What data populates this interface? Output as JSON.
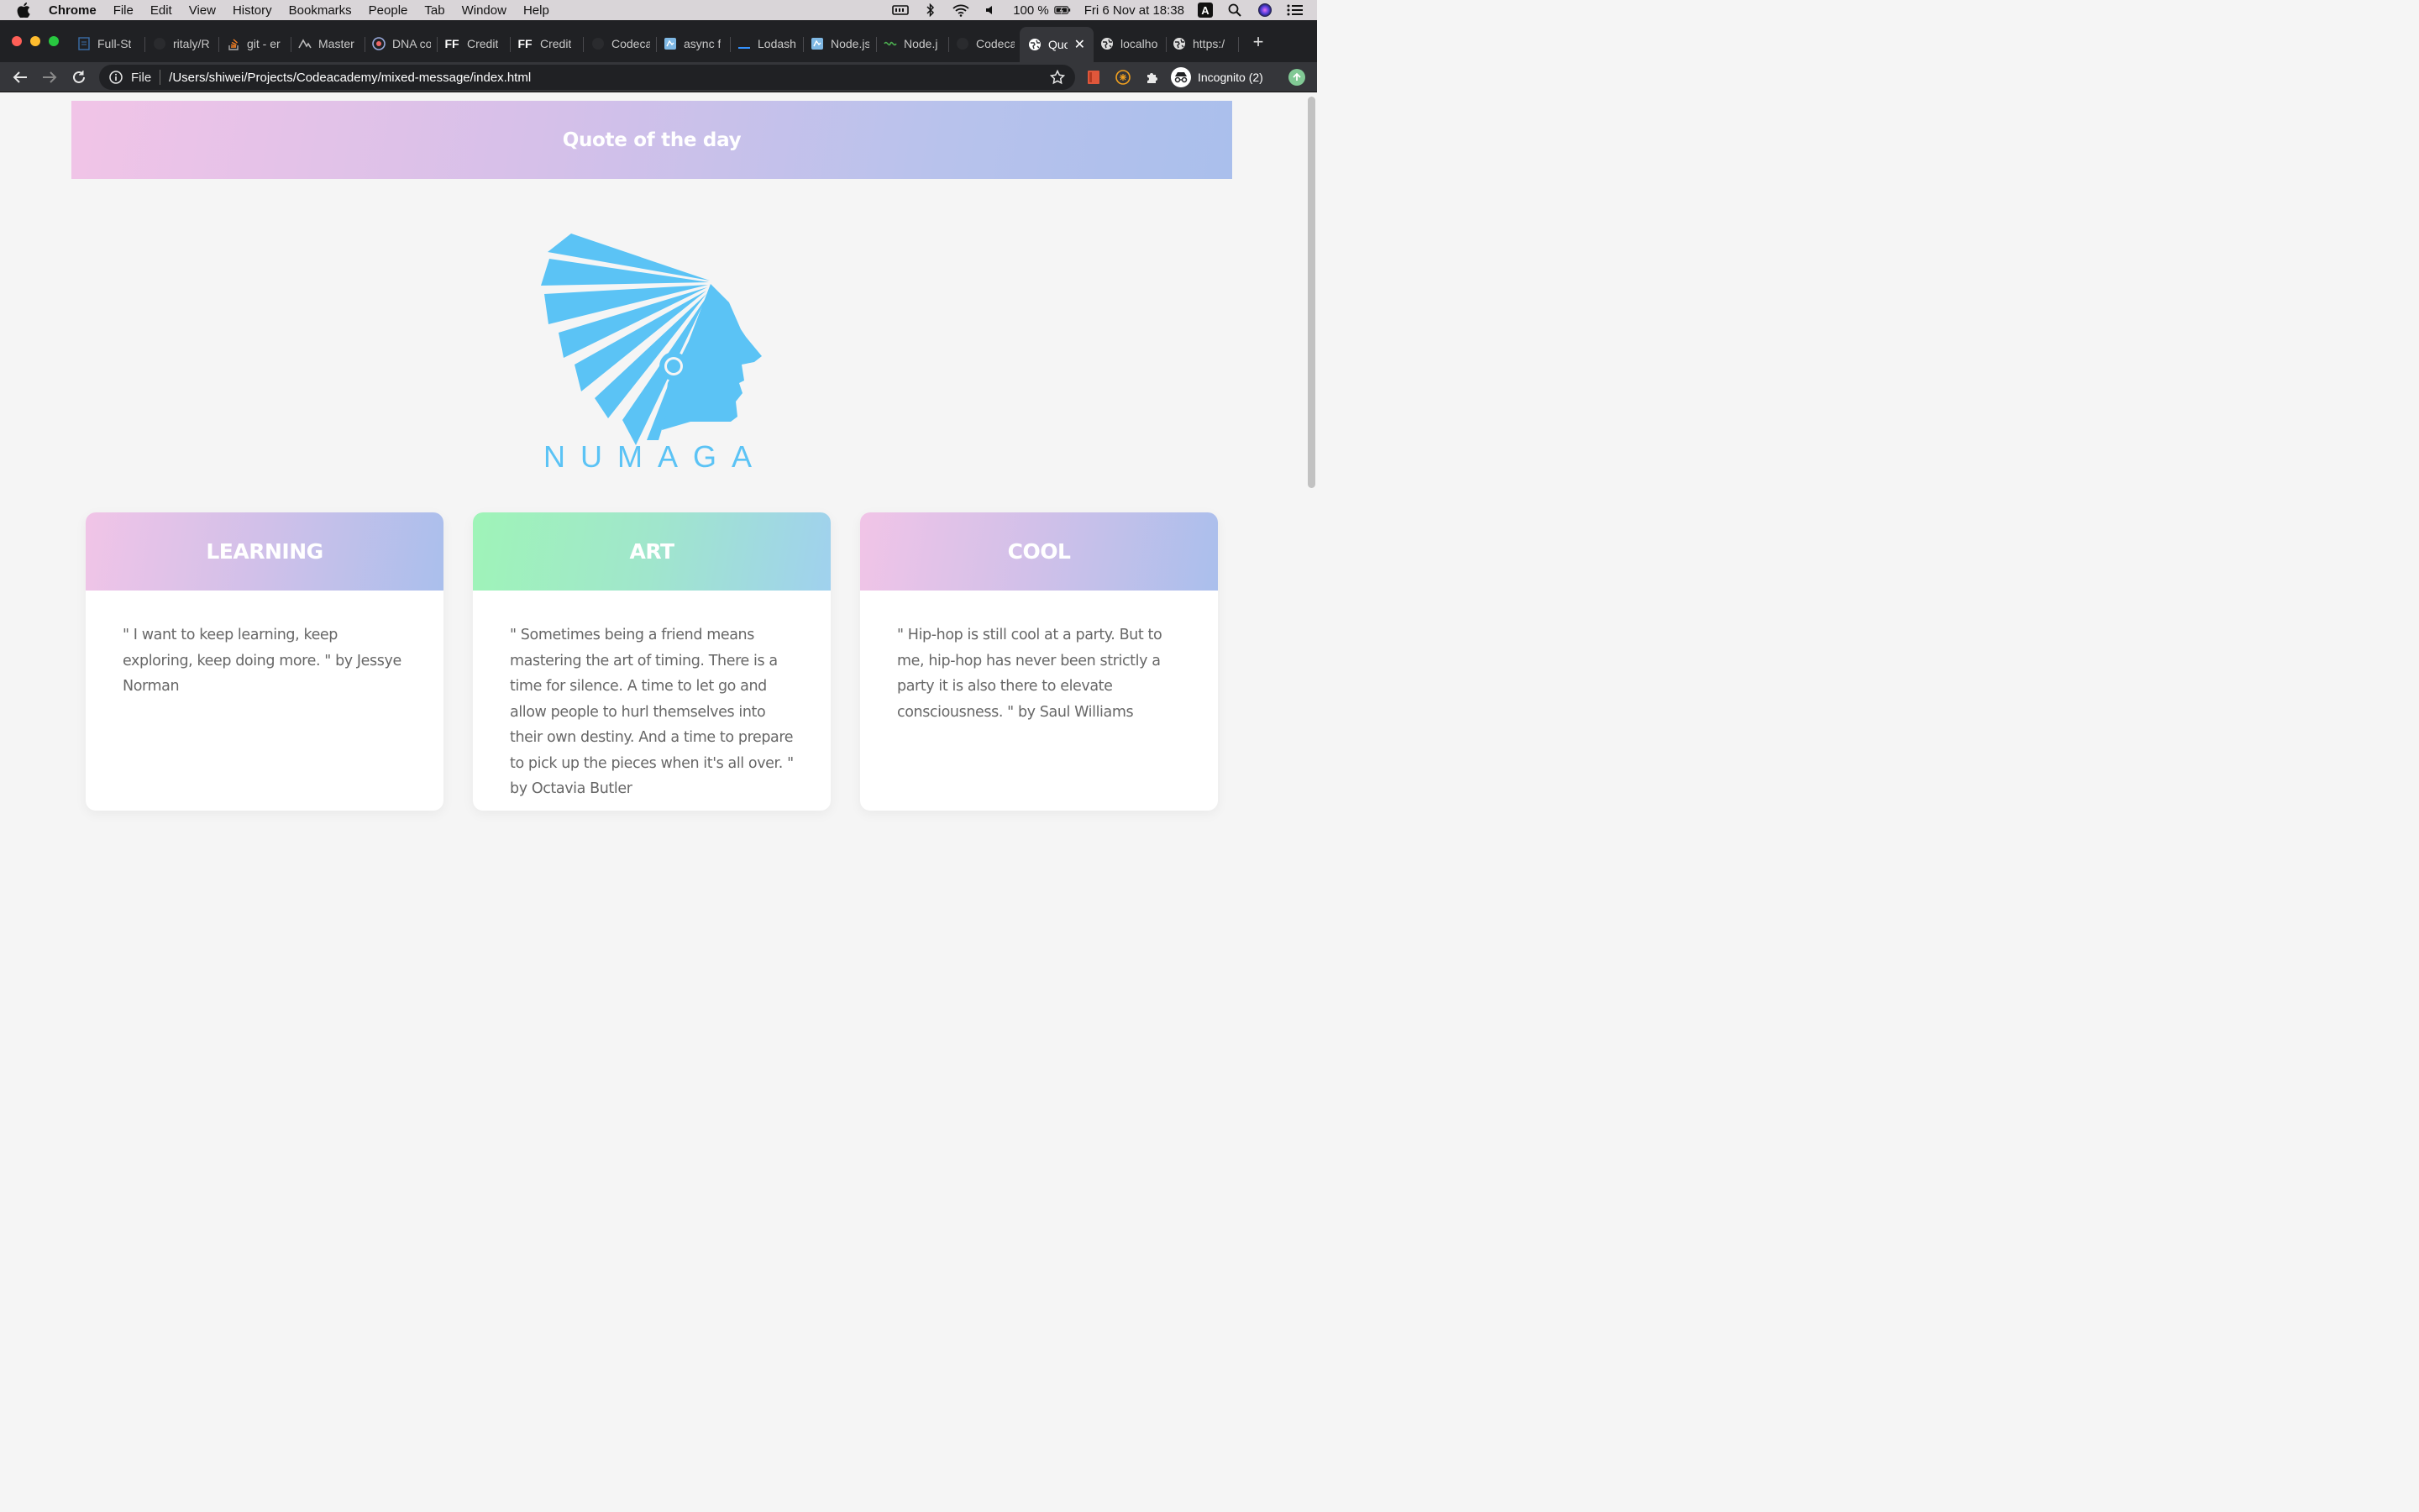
{
  "menubar": {
    "app_name": "Chrome",
    "items": [
      "File",
      "Edit",
      "View",
      "History",
      "Bookmarks",
      "People",
      "Tab",
      "Window",
      "Help"
    ],
    "battery": "100 %",
    "datetime": "Fri 6 Nov at  18:38",
    "input_source": "A"
  },
  "tabs": [
    {
      "label": "Full-St",
      "favicon": "document-icon"
    },
    {
      "label": "ritaly/R",
      "favicon": "github-icon"
    },
    {
      "label": "git - er",
      "favicon": "stackoverflow-icon"
    },
    {
      "label": "Master",
      "favicon": "codecademy-icon"
    },
    {
      "label": "DNA co",
      "favicon": "dna-icon"
    },
    {
      "label": "Credit",
      "favicon": "ff-icon"
    },
    {
      "label": "Credit",
      "favicon": "ff-icon"
    },
    {
      "label": "Codeca",
      "favicon": "github-icon"
    },
    {
      "label": "async f",
      "favicon": "async-icon"
    },
    {
      "label": "Lodash",
      "favicon": "lodash-icon"
    },
    {
      "label": "Node.js",
      "favicon": "node-icon"
    },
    {
      "label": "Node.j",
      "favicon": "node-green-icon"
    },
    {
      "label": "Codeca",
      "favicon": "github-icon"
    },
    {
      "label": "Quo",
      "favicon": "globe-icon",
      "active": true
    },
    {
      "label": "localho",
      "favicon": "globe-icon"
    },
    {
      "label": "https:/",
      "favicon": "globe-icon"
    }
  ],
  "omnibox": {
    "scheme": "File",
    "url": "/Users/shiwei/Projects/Codeacademy/mixed-message/index.html"
  },
  "profile": {
    "label": "Incognito (2)"
  },
  "page": {
    "title": "Quote of the day",
    "brand": "NUMAGA",
    "cards": [
      {
        "heading": "LEARNING",
        "quote": "\" I want to keep learning, keep exploring, keep doing more. \" by Jessye Norman"
      },
      {
        "heading": "ART",
        "quote": "\" Sometimes being a friend means mastering the art of timing. There is a time for silence. A time to let go and allow people to hurl themselves into their own destiny. And a time to prepare to pick up the pieces when it's all over. \" by Octavia Butler"
      },
      {
        "heading": "COOL",
        "quote": "\" Hip-hop is still cool at a party. But to me, hip-hop has never been strictly a party it is also there to elevate consciousness. \" by Saul Williams"
      }
    ]
  },
  "colors": {
    "accent_blue": "#5bc3f5",
    "gradient_pink": "#f1c4e7",
    "gradient_blue": "#aabfec",
    "gradient_green": "#9ff4b8"
  }
}
